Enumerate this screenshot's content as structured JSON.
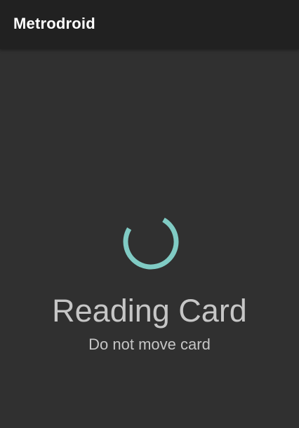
{
  "app_bar": {
    "title": "Metrodroid"
  },
  "main": {
    "status_title": "Reading Card",
    "status_subtitle": "Do not move card"
  },
  "spinner": {
    "icon": "progress-spinner-icon",
    "color": "#80cbc4"
  },
  "colors": {
    "app_bar_bg": "#212121",
    "background": "#303030",
    "text": "#c6c6c6",
    "accent": "#80cbc4"
  }
}
